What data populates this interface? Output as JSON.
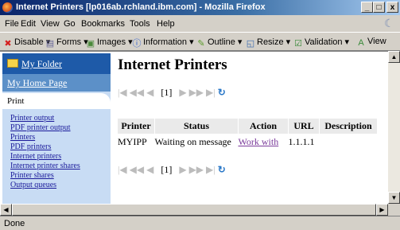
{
  "window": {
    "title": "Internet Printers [lp016ab.rchland.ibm.com] - Mozilla Firefox"
  },
  "window_controls": {
    "minimize": "_",
    "maximize": "□",
    "close": "x"
  },
  "menu": [
    "File",
    "Edit",
    "View",
    "Go",
    "Bookmarks",
    "Tools",
    "Help"
  ],
  "webdev_toolbar": [
    {
      "label": "Disable",
      "icon": "disable-icon"
    },
    {
      "label": "Forms",
      "icon": "forms-icon"
    },
    {
      "label": "Images",
      "icon": "images-icon"
    },
    {
      "label": "Information",
      "icon": "information-icon"
    },
    {
      "label": "Outline",
      "icon": "outline-icon"
    },
    {
      "label": "Resize",
      "icon": "resize-icon"
    },
    {
      "label": "Validation",
      "icon": "validation-icon"
    },
    {
      "label": "View",
      "icon": "view-source-icon"
    }
  ],
  "sidebar": {
    "my_folder": "My Folder",
    "home": "My Home Page",
    "section": "Print",
    "links": [
      "Printer output",
      "PDF printer output",
      "Printers",
      "PDF printers",
      "Internet printers",
      "Internet printer shares",
      "Printer shares",
      "Output queues"
    ]
  },
  "page": {
    "title": "Internet Printers",
    "pager": {
      "page": "[1]"
    },
    "table": {
      "headers": [
        "Printer",
        "Status",
        "Action",
        "URL",
        "Description"
      ],
      "rows": [
        {
          "printer": "MYIPP",
          "status": "Waiting on message",
          "action": "Work with",
          "url": "1.1.1.1",
          "description": ""
        }
      ]
    }
  },
  "status_bar": {
    "text": "Done"
  },
  "colors": {
    "titlebar": "#0a246a",
    "sidebar_header": "#1e5aa8",
    "sidebar_bg": "#c8dcf4",
    "link_visited": "#7a3a9a"
  }
}
